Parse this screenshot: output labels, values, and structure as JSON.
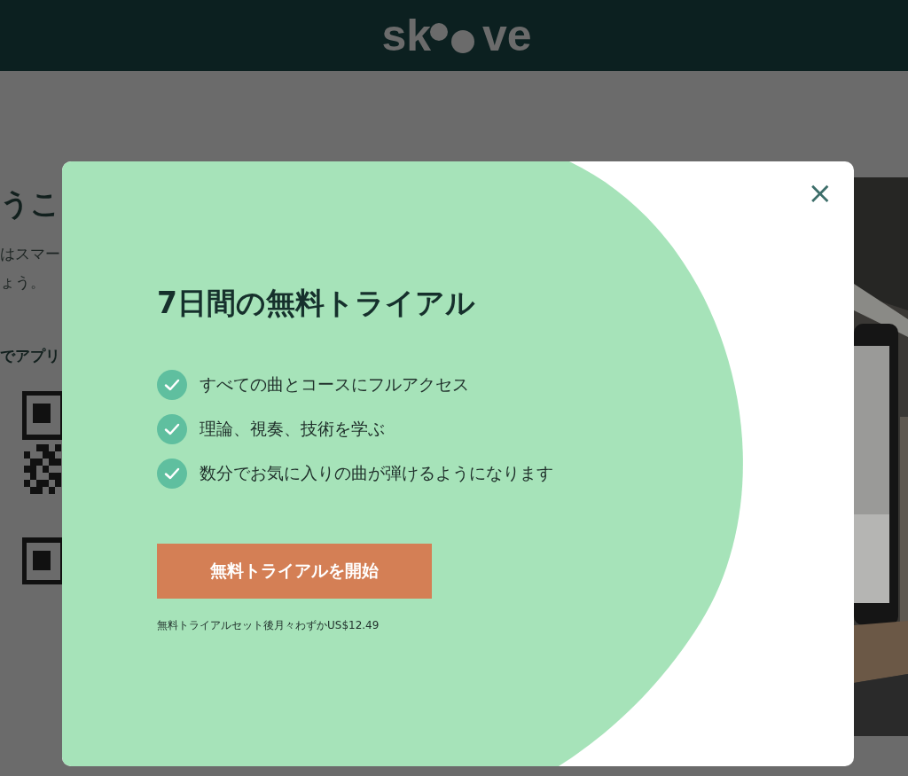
{
  "header": {
    "logo": [
      "sk",
      "ve"
    ]
  },
  "background": {
    "heading": "うこ",
    "lines": [
      "はスマー",
      "ょう。"
    ],
    "app_label": "でアプリ",
    "picture": {
      "kind": "picture"
    }
  },
  "modal": {
    "close": "×",
    "title": "7日間の無料トライアル",
    "features": [
      {
        "text": "すべての曲とコースにフルアクセス",
        "checked": true
      },
      {
        "text": "理論、視奏、技術を学ぶ",
        "checked": true
      },
      {
        "text": "数分でお気に入りの曲が弾けるようになります",
        "checked": true
      }
    ],
    "button": "無料トライアルを開始",
    "note": "無料トライアルセット後月々わずかUS$12.49"
  }
}
